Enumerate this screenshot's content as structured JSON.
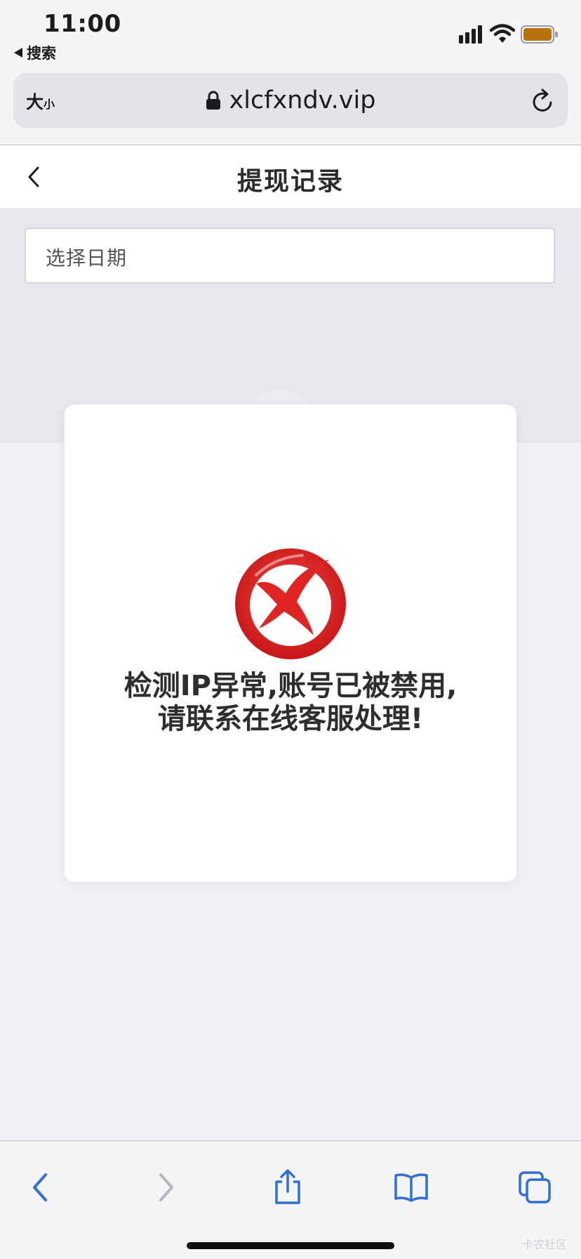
{
  "status_bar": {
    "time": "11:00",
    "back_app_label": "搜索",
    "battery_color": "#b8730c"
  },
  "address_bar": {
    "text_size_big": "大",
    "text_size_small": "小",
    "url": "xlcfxndv.vip"
  },
  "header": {
    "title": "提现记录"
  },
  "filter": {
    "date_placeholder": "选择日期"
  },
  "alert": {
    "line1": "检测IP异常,账号已被禁用,",
    "line2": "请联系在线客服处理!",
    "icon": "error-x-icon",
    "icon_color": "#e02424"
  },
  "toolbar": {
    "items": [
      "back",
      "forward",
      "share",
      "bookmarks",
      "tabs"
    ],
    "accent_color": "#2f6fd6"
  },
  "watermark": "卡农社区"
}
